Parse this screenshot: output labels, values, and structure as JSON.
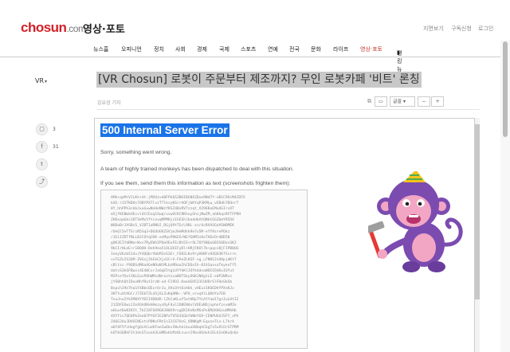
{
  "header": {
    "logo_main": "chosun",
    "logo_suffix": ".com",
    "section_title": "영상·포토",
    "util_links": [
      "지면보기",
      "구독신청",
      "로그인"
    ]
  },
  "nav": {
    "items": [
      "뉴스홈",
      "오피니언",
      "정치",
      "사회",
      "경제",
      "국제",
      "스포츠",
      "연예",
      "전국",
      "문화",
      "라이프",
      "영상·포토",
      "랭킹뉴스"
    ],
    "active": "영상·포토"
  },
  "breadcrumb": {
    "label": "VR"
  },
  "article": {
    "title": "[VR Chosun] 로봇이 주문부터 제조까지? 무인 로봇카페 '비트' 론칭",
    "byline": "김유섬 기자",
    "share_label": "공유",
    "font_label": "글꼴"
  },
  "sidebar": {
    "comment_count": "3",
    "facebook_count": "31",
    "facebook_icon": "f",
    "twitter_icon": "t"
  },
  "error": {
    "title": "500 Internal Server Error",
    "p1": "Sorry, something went wrong.",
    "p2": "A team of highly trained monkeys has been dispatched to deal with this situation.",
    "p3": "If you see them, send them this information as text (screenshots frighten them):",
    "trace": "AMk+qeMrVJLKh+dt-jMXOzvd8FPk6S3BUIBGNX2Dxe9Nd7Y-nB1C9OcM4ID55\nkXG-r15TKDUs7OBYPXTlvzTTlkcyKGrrAOFjbKYqP3KMLw_vEBdh7DUnrT\n8Y_hhPPh3ckbJxuGxwNnHeNWzfKSZ4BsRV7zzqt_V296KoEMuOGIrxOT\nm5jfKEBmkUEcvl4tCEoqIXwqrvvwOCKCRKhuyGhsjNwZM_aG8kqsRFTFPRH\nZHOxqaGks1DTSkMv5ftszvqMPMHjzIhEShlbaddkAtQNktGGZbmYR5UV\nWUDaBrJASBcS_VJBT1aRNUJ_DGjQ9tTGrL9BL-xsrOcBVASGoVSWOMEK\nrOeQl5eTTSrzN5Sq3+DGUUGKZSVjmJHeMdhh9e7u5M-eYY9zrePQkz\nr1E1IZDTfNLLBJCOYqCKK-esMqsPDKEGrWEfGHMIsHoTHOzOrdBD50\ngOK3EIYdBNo+Wxs7RyEWhIPQeOEeFEcBtES+rOL7OYSNQuGB3S6DocGK2\n9bCIrHLeE+r1BOOH-Deh9ea51OLEKIFyDl+HRjFKUl7b+pqcsBjFIPBBUG\nIeeyVbzbS14vJY4QQbrVbbMJxS3Er_FOEELKv9ryHOBFsHXQO3KfSsrrn\nvvTGZn2S26M-ZVGsj2hEkCXjxSC+V-FAeZLKSF-sg_u7NOSJsUHpjdKt7\ncBltzc-Y9ODSdMUa4GeNRaNlMLbzMOoa2hCDOnIh-01ASavsaTkykeTf5\nUatsS3kSFBwvi4E40CvrJxOqE5tgLUYYkKlJOYk4dcoWOCG5hKxIOfut\nMIPsefVxtIKLEosPOhWMzdNroztzvaNUTSkyOGKJNOgtLE-edP2NRvz\njYSBhhQtIDuxNhfRut3rzN-xd-FI9OI-HaedEH523CUUDrSlFHeSbSb\nBspchJ9e7ha1F4BbsQExrOrJu_XALOtt6sHUk_vHEuiSKOEDVfPXnKJv\n3KTtuXtHGCrJ7ZEbTZL4Sj6LZuKqHNb--VPU_vrxqVlLQHUYa7EB\nTnuJnuIYk5M8XYfDIIXDB4D-lZhCoKLuf5otHRpTYLAYYumI7gsIuLHtI2\n21IDFEOwzJZeXGhOKkHAmzysRyFdul2OBENdxlVOEaNOjnphnfzsvmMZe\naHLwtBuNIKIt_TkI3XFOO9GHJ80X9rsgEKIHsNsMSzPx8ROXHGzuHMhHb\n4XYYiv7QE8PkZeo07PYOFIE2BPxTV5OJGGbfbNbYG9-CENPUU4JSFY_vPh\nZ46G2UuJDVOINEvtcPDNsFRtInI2C6THcG_VDNKgM-EquseTLn-L7hrA\na6Y4F5fiHogfgQsXCuxKFaeIw6kvIWvhkibuuU8bqhCbgTx5u91OrGTPRM\nkOTkG6BhFIt3dsGTxxoA3LbMDxHcMz8LcuvsI9bxOGduh1ELhIeOKuQnQs"
  }
}
